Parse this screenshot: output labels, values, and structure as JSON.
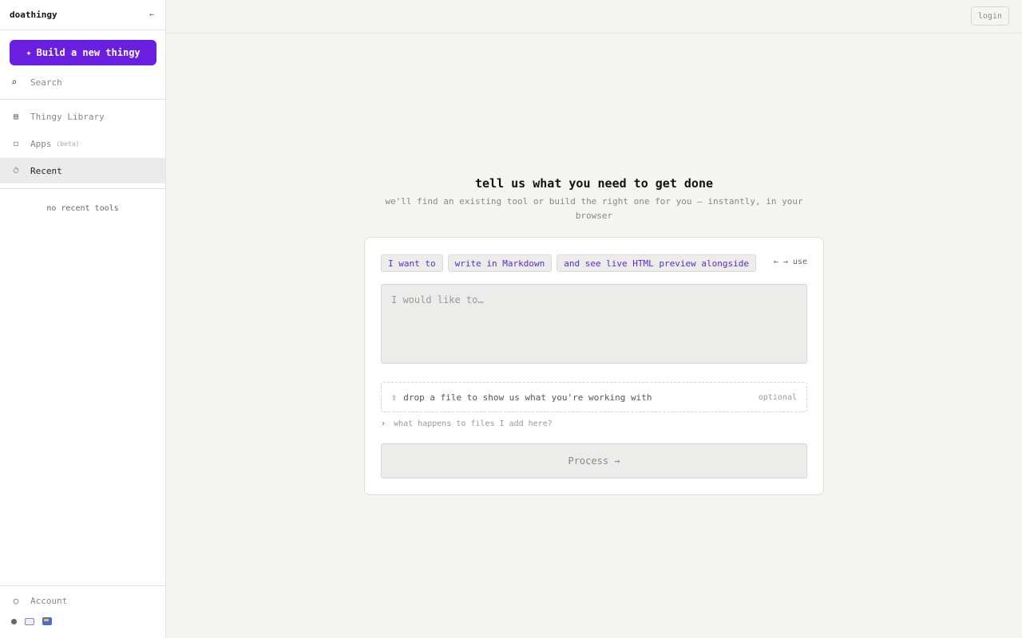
{
  "sidebar": {
    "brand": "doathingy",
    "collapse_icon": "←",
    "build_button": {
      "icon": "✦",
      "label": "Build a new thingy"
    },
    "search": {
      "icon": "⌕",
      "label": "Search"
    },
    "nav": [
      {
        "icon": "▤",
        "label": "Thingy Library",
        "badge": ""
      },
      {
        "icon": "◻",
        "label": "Apps",
        "badge": "(beta)"
      },
      {
        "icon": "⏱",
        "label": "Recent",
        "badge": ""
      }
    ],
    "empty_recent": "no recent tools",
    "account": {
      "icon": "○",
      "label": "Account"
    }
  },
  "topbar": {
    "login_label": "login"
  },
  "hero": {
    "title": "tell us what you need to get done",
    "subtitle": "we'll find an existing tool or build the right one for you — instantly, in your browser"
  },
  "card": {
    "pills": [
      "I want to",
      "write in Markdown",
      "and see live HTML preview alongside"
    ],
    "pill_nav": "← → use",
    "textarea_placeholder": "I would like to…",
    "dropzone": {
      "icon": "⇪",
      "label": "drop a file to show us what you're working with",
      "optional": "optional"
    },
    "files_note": {
      "chevron": "›",
      "label": "what happens to files I add here?"
    },
    "process_label": "Process →"
  },
  "colors": {
    "accent": "#6a1fe0",
    "pill_text": "#5b2bd1"
  }
}
